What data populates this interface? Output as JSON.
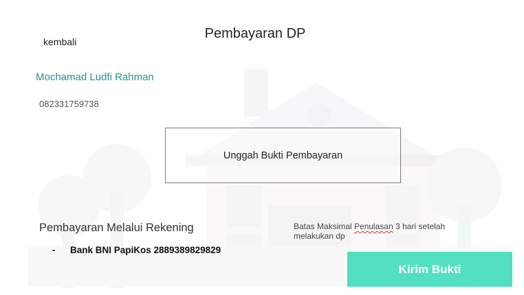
{
  "nav": {
    "back_label": "kembali"
  },
  "page": {
    "title": "Pembayaran DP"
  },
  "user": {
    "name": "Mochamad Ludfi Rahman",
    "phone": "082331759738"
  },
  "upload": {
    "label": "Unggah Bukti Pembayaran"
  },
  "rekening": {
    "heading": "Pembayaran Melalui Rekening",
    "items": [
      {
        "bullet": "-",
        "text": "Bank BNI PapiKos 2889389829829"
      }
    ]
  },
  "deadline": {
    "prefix": "Batas Maksimal ",
    "misspelled": "Penulasan",
    "suffix": " 3 hari setelah melakukan dp"
  },
  "submit": {
    "label": "Kirim Bukti"
  },
  "colors": {
    "accent": "#52e0c0",
    "name_color": "#2a8f92",
    "illustration": "#f2f5f3"
  },
  "icons": {
    "background": "house-illustration"
  }
}
